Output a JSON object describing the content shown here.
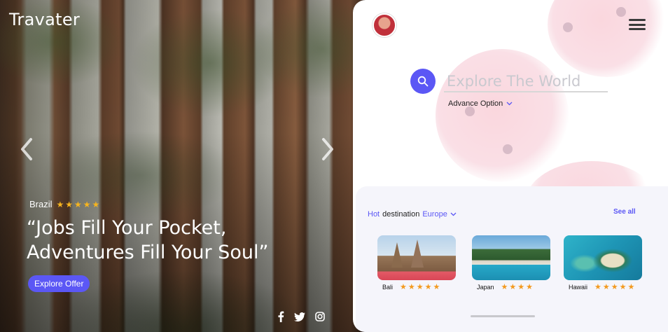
{
  "hero": {
    "brand": "Travater",
    "location": "Brazil",
    "rating_stars": "★★★★★",
    "quote": "“Jobs Fill Your Pocket,\nAdventures Fill Your Soul”",
    "cta_label": "Explore Offer",
    "socials": [
      "facebook-icon",
      "twitter-icon",
      "instagram-icon"
    ]
  },
  "panel": {
    "search": {
      "placeholder": "Explore The World",
      "advance_label": "Advance Option"
    },
    "destinations": {
      "hot_label": "Hot",
      "destination_label": "destination",
      "region": "Europe",
      "see_all_label": "See all",
      "items": [
        {
          "name": "Bali",
          "stars": "★★★★★"
        },
        {
          "name": "Japan",
          "stars": "★★★★"
        },
        {
          "name": "Hawaii",
          "stars": "★★★★★"
        }
      ]
    }
  },
  "colors": {
    "accent": "#5b57f5",
    "star": "#f6b41e"
  }
}
